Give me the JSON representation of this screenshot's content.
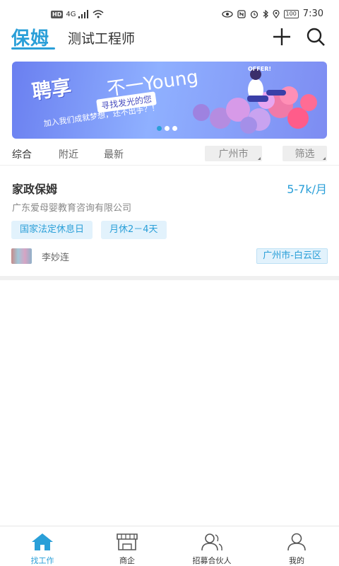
{
  "status_bar": {
    "network": "4G",
    "hd": "HD",
    "battery": "100",
    "time": "7:30"
  },
  "header": {
    "logo": "保姆",
    "title": "测试工程师"
  },
  "banner": {
    "headline": "聘享",
    "headline_latin": "不一Young",
    "subtitle": "寻找发光的您",
    "tagline": "加入我们成就梦想，还不出手？！",
    "badge": "OFFER!",
    "active_slide": 1,
    "slide_count": 3
  },
  "filter_tabs": [
    {
      "label": "综合",
      "active": true
    },
    {
      "label": "附近",
      "active": false
    },
    {
      "label": "最新",
      "active": false
    }
  ],
  "filters": {
    "city": "广州市",
    "more": "筛选"
  },
  "job": {
    "title": "家政保姆",
    "salary": "5-7k/月",
    "company": "广东爱母婴教育咨询有限公司",
    "tags": [
      "国家法定休息日",
      "月休2－4天"
    ],
    "recruiter": "李妙连",
    "location": "广州市-白云区"
  },
  "bottom_nav": [
    {
      "label": "找工作",
      "icon": "home-icon",
      "active": true
    },
    {
      "label": "商企",
      "icon": "store-icon",
      "active": false
    },
    {
      "label": "招募合伙人",
      "icon": "partners-icon",
      "active": false
    },
    {
      "label": "我的",
      "icon": "profile-icon",
      "active": false
    }
  ],
  "colors": {
    "accent": "#2a9fd8",
    "tag_bg": "#e2f2fc"
  }
}
